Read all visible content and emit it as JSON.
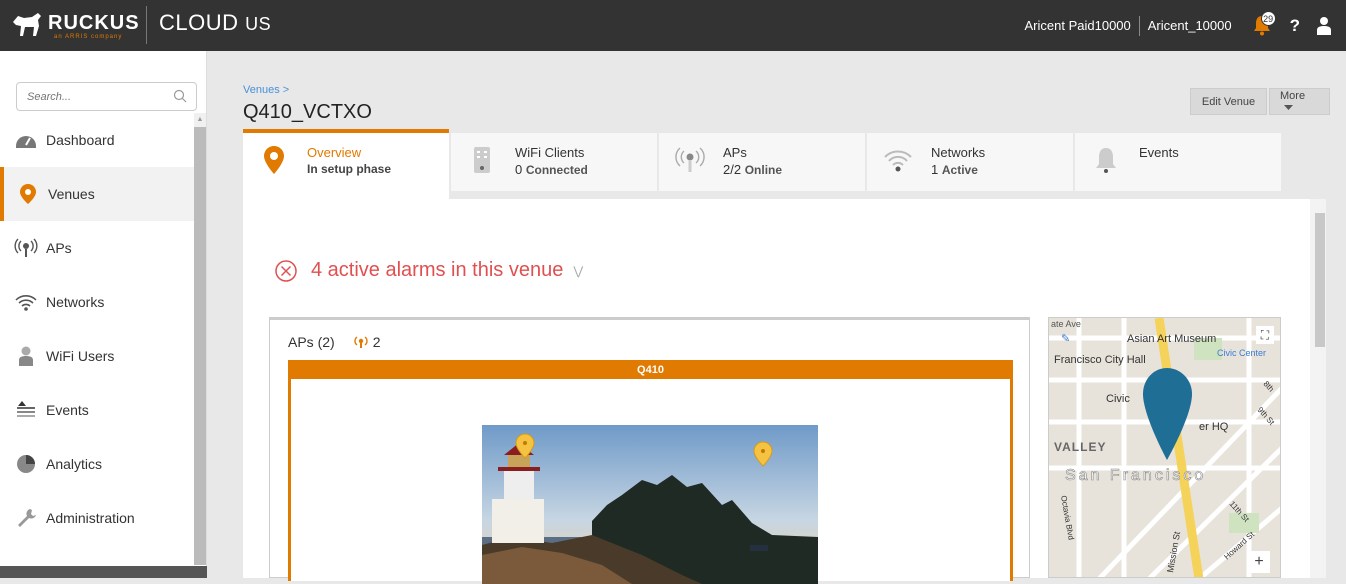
{
  "header": {
    "brand": "RUCKUS",
    "brand_sub": "an ARRIS company",
    "product": "CLOUD",
    "region": "US",
    "account": "Aricent Paid10000",
    "tenant": "Aricent_10000",
    "notifications": "29",
    "help": "?"
  },
  "sidebar": {
    "search_placeholder": "Search...",
    "items": [
      {
        "label": "Dashboard",
        "icon": "dashboard-icon"
      },
      {
        "label": "Venues",
        "icon": "venue-pin-icon",
        "active": true
      },
      {
        "label": "APs",
        "icon": "ap-signal-icon"
      },
      {
        "label": "Networks",
        "icon": "wifi-icon"
      },
      {
        "label": "WiFi Users",
        "icon": "user-icon"
      },
      {
        "label": "Events",
        "icon": "events-icon"
      },
      {
        "label": "Analytics",
        "icon": "analytics-icon"
      },
      {
        "label": "Administration",
        "icon": "wrench-icon"
      }
    ]
  },
  "page": {
    "breadcrumb": "Venues >",
    "title": "Q410_VCTXO",
    "edit_button": "Edit Venue",
    "more_button": "More"
  },
  "tabs": [
    {
      "title": "Overview",
      "sub": "In setup phase",
      "active": true
    },
    {
      "title": "WiFi Clients",
      "count": "0",
      "unit": "Connected"
    },
    {
      "title": "APs",
      "count": "2/2",
      "unit": "Online"
    },
    {
      "title": "Networks",
      "count": "1",
      "unit": "Active"
    },
    {
      "title": "Events",
      "count": "",
      "unit": ""
    }
  ],
  "alarms": {
    "text": "4 active alarms in this venue"
  },
  "aps_panel": {
    "title": "APs (2)",
    "count": "2",
    "floor_name": "Q410"
  },
  "map": {
    "labels": [
      "ate Ave",
      "Asian Art Museum",
      "Francisco City Hall",
      "Civic Center",
      "Civic",
      "er HQ",
      "VALLEY",
      "San Francisco",
      "Octavia Blvd",
      "Mission St",
      "Howard St",
      "11th St",
      "9th St",
      "8th"
    ]
  },
  "colors": {
    "accent": "#e07a00",
    "alarm": "#e05050",
    "link": "#4a90d9",
    "topbar": "#333333",
    "map_pin": "#1f6e96"
  }
}
